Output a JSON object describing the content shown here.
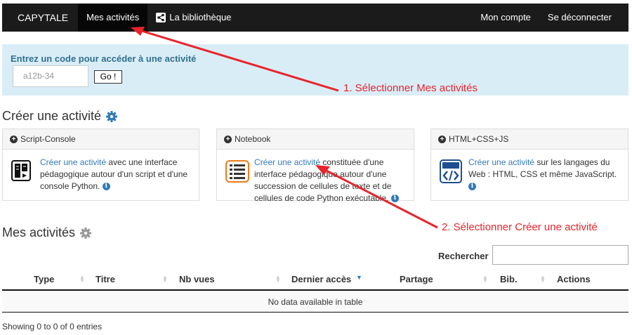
{
  "nav": {
    "brand": "CAPYTALE",
    "my_activities": "Mes activités",
    "library": "La bibliothèque",
    "account": "Mon compte",
    "logout": "Se déconnecter"
  },
  "code_panel": {
    "label": "Entrez un code pour accéder à une activité",
    "placeholder": "a12b-34",
    "go": "Go !"
  },
  "create": {
    "title": "Créer une activité",
    "link": "Créer une activité",
    "cards": [
      {
        "header": "Script-Console",
        "text_after": " avec une interface pédagogique autour d'un script et d'une console Python."
      },
      {
        "header": "Notebook",
        "text_after": " constituée d'une interface pédagogique autour d'une succession de cellules de texte et de cellules de code Python exécutable."
      },
      {
        "header": "HTML+CSS+JS",
        "text_after": " sur les langages du Web : HTML, CSS et même JavaScript."
      }
    ]
  },
  "activities": {
    "title": "Mes activités",
    "search_label": "Rechercher",
    "columns": [
      "Type",
      "Titre",
      "Nb vues",
      "Dernier accès",
      "Partage",
      "Bib.",
      "Actions"
    ],
    "empty": "No data available in table",
    "showing": "Showing 0 to 0 of 0 entries"
  },
  "annotations": {
    "step1": "1. Sélectionner Mes activités",
    "step2": "2. Sélectionner Créer une activité"
  },
  "colors": {
    "navbar": "#1b1b1b",
    "panel": "#d9edf7",
    "link": "#337ab7",
    "annotation": "#e8242b"
  }
}
